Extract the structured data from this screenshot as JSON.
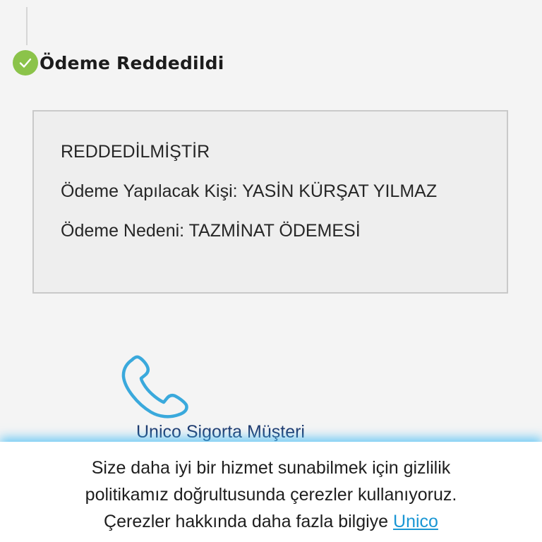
{
  "status": {
    "title": "Ödeme Reddedildi",
    "icon": "check-circle-icon",
    "icon_color": "#8bc34a"
  },
  "payment_info": {
    "status_text": "REDDEDİLMİŞTİR",
    "payee_label": "Ödeme Yapılacak Kişi:",
    "payee_name": "YASİN KÜRŞAT YILMAZ",
    "reason_label": "Ödeme Nedeni:",
    "reason_value": "TAZMİNAT ÖDEMESİ"
  },
  "contact": {
    "icon": "phone-icon",
    "label": "Unico Sigorta Müşteri",
    "icon_color": "#3aa9dc"
  },
  "cookie_banner": {
    "line1": "Size daha iyi bir hizmet sunabilmek için gizlilik",
    "line2": "politikamız doğrultusunda çerezler kullanıyoruz.",
    "line3_prefix": "Çerezler hakkında daha fazla bilgiye",
    "link_text": "Unico",
    "link_color": "#1a96d4"
  }
}
